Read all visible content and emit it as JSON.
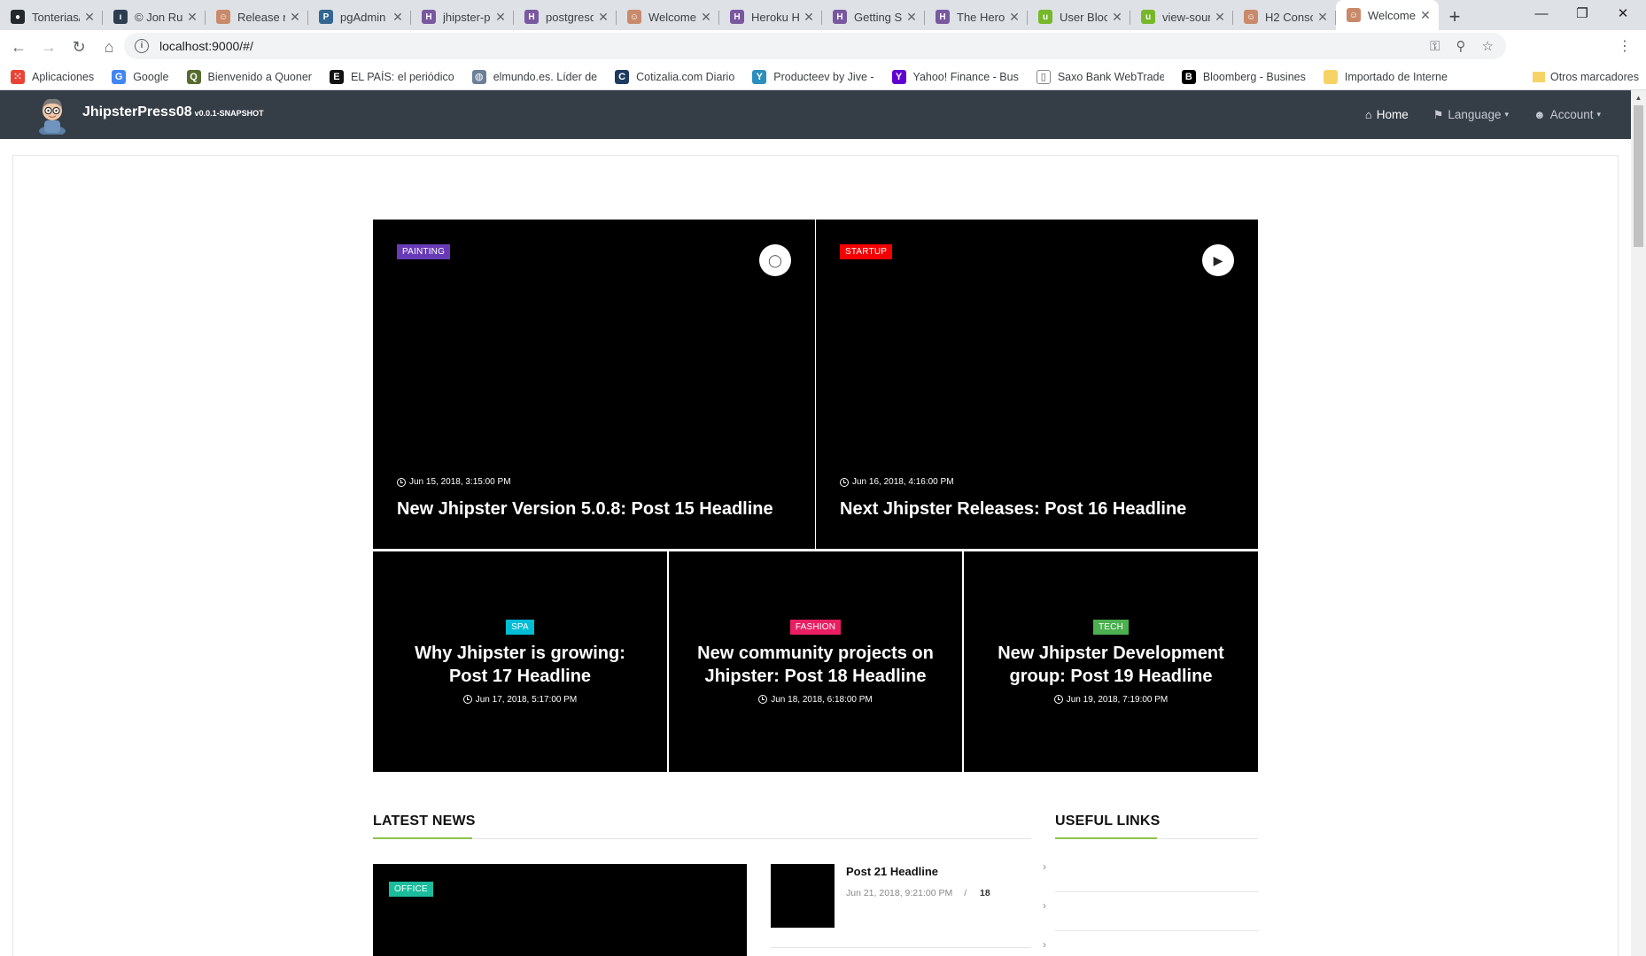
{
  "browser": {
    "tabs": [
      {
        "title": "Tonterias/",
        "color": "#24292e",
        "glyph": "●"
      },
      {
        "title": "© Jon Ru",
        "color": "#2d3e50",
        "glyph": "ı"
      },
      {
        "title": "Release n",
        "color": "#c98a6b",
        "glyph": "☺"
      },
      {
        "title": "pgAdmin",
        "color": "#336791",
        "glyph": "P"
      },
      {
        "title": "jhipster-p",
        "color": "#79589f",
        "glyph": "H"
      },
      {
        "title": "postgresq",
        "color": "#79589f",
        "glyph": "H"
      },
      {
        "title": "Welcome",
        "color": "#c98a6b",
        "glyph": "☺"
      },
      {
        "title": "Heroku H",
        "color": "#79589f",
        "glyph": "H"
      },
      {
        "title": "Getting St",
        "color": "#79589f",
        "glyph": "H"
      },
      {
        "title": "The Herol",
        "color": "#79589f",
        "glyph": "H"
      },
      {
        "title": "User Bloc",
        "color": "#76b82a",
        "glyph": "u"
      },
      {
        "title": "view-sour",
        "color": "#76b82a",
        "glyph": "u"
      },
      {
        "title": "H2 Conso",
        "color": "#c98a6b",
        "glyph": "☺"
      },
      {
        "title": "Welcome",
        "color": "#c98a6b",
        "glyph": "☺",
        "active": true
      }
    ],
    "url": "localhost:9000/#/",
    "bookmarks": [
      {
        "label": "Aplicaciones",
        "color": "#ea4335",
        "glyph": "⁙"
      },
      {
        "label": "Google",
        "color": "#4285f4",
        "glyph": "G"
      },
      {
        "label": "Bienvenido a Quoner",
        "color": "#556b2f",
        "glyph": "Q"
      },
      {
        "label": "EL PAÍS: el periódico",
        "color": "#111111",
        "glyph": "E"
      },
      {
        "label": "elmundo.es. Líder de",
        "color": "#6b7f99",
        "glyph": "◍"
      },
      {
        "label": "Cotizalia.com Diario",
        "color": "#1e3a5f",
        "glyph": "C"
      },
      {
        "label": "Producteev by Jive -",
        "color": "#2a8fbd",
        "glyph": "Y"
      },
      {
        "label": "Yahoo! Finance - Bus",
        "color": "#5f01d1",
        "glyph": "Y"
      },
      {
        "label": "Saxo Bank WebTrade",
        "color": "#ffffff",
        "glyph": "▯"
      },
      {
        "label": "Bloomberg - Busines",
        "color": "#000000",
        "glyph": "B"
      },
      {
        "label": "Importado de Interne",
        "color": "#f6d365",
        "glyph": ""
      }
    ],
    "other_bookmarks": "Otros marcadores"
  },
  "app": {
    "brand": "JhipsterPress08",
    "version": "v0.0.1-SNAPSHOT",
    "nav": {
      "home": "Home",
      "language": "Language",
      "account": "Account"
    }
  },
  "featured": {
    "big": [
      {
        "badge": "PAINTING",
        "badge_color": "#673ab7",
        "media": "camera-icon",
        "date": "Jun 15, 2018, 3:15:00 PM",
        "title": "New Jhipster Version 5.0.8: Post 15 Headline"
      },
      {
        "badge": "STARTUP",
        "badge_color": "#f50000",
        "media": "play-icon",
        "date": "Jun 16, 2018, 4:16:00 PM",
        "title": "Next Jhipster Releases: Post 16 Headline"
      }
    ],
    "small": [
      {
        "badge": "SPA",
        "badge_color": "#00bcd4",
        "title": "Why Jhipster is growing: Post 17 Headline",
        "date": "Jun 17, 2018, 5:17:00 PM"
      },
      {
        "badge": "FASHION",
        "badge_color": "#e91e63",
        "title": "New community projects on Jhipster: Post 18 Headline",
        "date": "Jun 18, 2018, 6:18:00 PM"
      },
      {
        "badge": "TECH",
        "badge_color": "#4caf50",
        "title": "New Jhipster Development group: Post 19 Headline",
        "date": "Jun 19, 2018, 7:19:00 PM"
      }
    ]
  },
  "latest_news": {
    "heading": "LATEST NEWS",
    "feature_badge": "OFFICE",
    "feature_badge_color": "#1abc9c",
    "items": [
      {
        "title": "Post 21 Headline",
        "date": "Jun 21, 2018, 9:21:00 PM",
        "sep": "/",
        "count": "18"
      }
    ]
  },
  "useful_links": {
    "heading": "USEFUL LINKS"
  },
  "colors": {
    "accent": "#8bc34a",
    "navbar": "#353d47"
  }
}
